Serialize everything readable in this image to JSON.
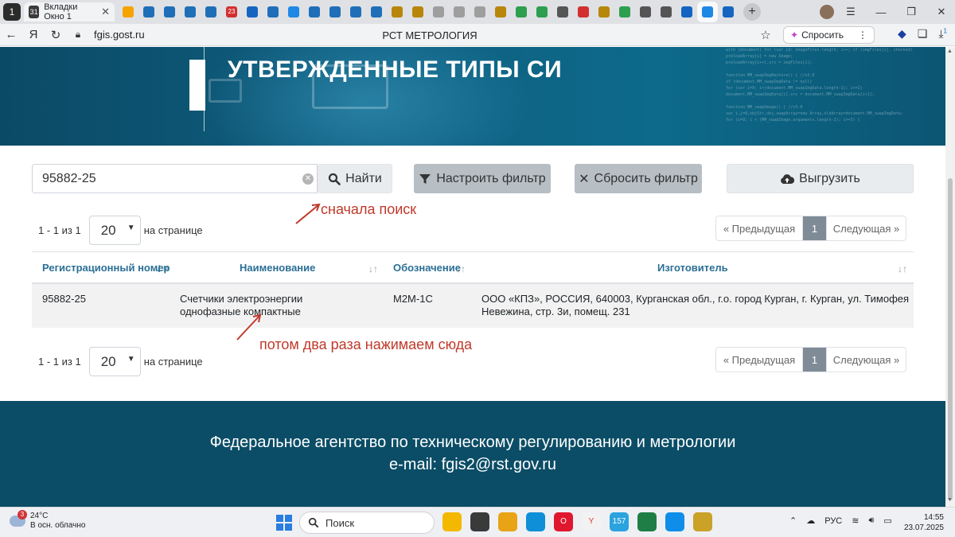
{
  "browser": {
    "tab_count": "1",
    "active_tab": {
      "label": "Вкладки Окно 1",
      "calendar_day": "31"
    },
    "favicons": [
      {
        "name": "mail-favicon",
        "color": "#f4a300",
        "label": ""
      },
      {
        "name": "site-favicon-1",
        "color": "#1f6fb8",
        "label": ""
      },
      {
        "name": "site-favicon-2",
        "color": "#1f6fb8",
        "label": ""
      },
      {
        "name": "site-favicon-3",
        "color": "#1f6fb8",
        "label": ""
      },
      {
        "name": "site-favicon-4",
        "color": "#1f6fb8",
        "label": ""
      },
      {
        "name": "badge-favicon",
        "color": "#d32f2f",
        "label": "23"
      },
      {
        "name": "site-favicon-5",
        "color": "#1565c0",
        "label": ""
      },
      {
        "name": "site-favicon-6",
        "color": "#1f6fb8",
        "label": ""
      },
      {
        "name": "shield-favicon",
        "color": "#1e88e5",
        "label": ""
      },
      {
        "name": "site-favicon-7",
        "color": "#1f6fb8",
        "label": ""
      },
      {
        "name": "site-favicon-8",
        "color": "#1f6fb8",
        "label": ""
      },
      {
        "name": "site-favicon-9",
        "color": "#1f6fb8",
        "label": ""
      },
      {
        "name": "site-favicon-10",
        "color": "#1f6fb8",
        "label": ""
      },
      {
        "name": "emblem-favicon-1",
        "color": "#b8860b",
        "label": ""
      },
      {
        "name": "emblem-favicon-2",
        "color": "#b8860b",
        "label": ""
      },
      {
        "name": "document-favicon-1",
        "color": "#9e9e9e",
        "label": ""
      },
      {
        "name": "document-favicon-2",
        "color": "#9e9e9e",
        "label": ""
      },
      {
        "name": "document-favicon-3",
        "color": "#9e9e9e",
        "label": ""
      },
      {
        "name": "emblem-favicon-3",
        "color": "#b8860b",
        "label": ""
      },
      {
        "name": "green-cross-favicon-1",
        "color": "#2e9e4f",
        "label": ""
      },
      {
        "name": "green-cross-favicon-2",
        "color": "#2e9e4f",
        "label": ""
      },
      {
        "name": "figure-favicon-1",
        "color": "#555555",
        "label": ""
      },
      {
        "name": "red-diamond-favicon",
        "color": "#d32f2f",
        "label": ""
      },
      {
        "name": "emblem-favicon-4",
        "color": "#b8860b",
        "label": ""
      },
      {
        "name": "green-cross-favicon-3",
        "color": "#2e9e4f",
        "label": ""
      },
      {
        "name": "figure-favicon-2",
        "color": "#555555",
        "label": ""
      },
      {
        "name": "figure-favicon-3",
        "color": "#555555",
        "label": ""
      },
      {
        "name": "blue-dot-favicon-1",
        "color": "#1565c0",
        "label": ""
      },
      {
        "name": "active-site-favicon",
        "color": "#1e88e5",
        "label": ""
      },
      {
        "name": "blue-dot-favicon-2",
        "color": "#1565c0",
        "label": ""
      }
    ],
    "address": {
      "host": "fgis.gost.ru",
      "page_title": "РСТ МЕТРОЛОГИЯ"
    },
    "ask_button": "Спросить",
    "downloads_badge": "1"
  },
  "page": {
    "banner_title": "УТВЕРЖДЕННЫЕ ТИПЫ СИ",
    "banner_code": "with (document) for (var id: imageFiles.length; i++) if (imgFiles[i]. checked)\npreloadArray[i] = new Image;\npreloadArray[i++].src = imgFiles[i];\n\nfunction MM_swapImgRestore() { //v3.0\nif (document.MM_swapImgData != null)\nfor (var i=0; i<(document.MM_swapImgData.length-1); i+=2)\ndocument.MM_swapImgData[i].src = document.MM_swapImgData[i+1];\n\nfunction MM_swapImage() { //v3.0\nvar i,j=0,objStr,obj,swapArray=new Array,oldArray=document.MM_swapImgData;\nfor (i=0; i < (MM_swapImage.arguments.length-2); i+=3) {",
    "search": {
      "value": "95882-25",
      "placeholder": ""
    },
    "buttons": {
      "find": "Найти",
      "configure_filter": "Настроить фильтр",
      "reset_filter": "Сбросить фильтр",
      "export": "Выгрузить"
    },
    "annotations": {
      "first": "сначала поиск",
      "second": "потом два раза нажимаем сюда",
      "color": "#c0392b"
    },
    "pagination": {
      "range_text": "1 - 1 из 1",
      "page_size": "20",
      "per_page_label": "на странице",
      "prev": "Предыдущая",
      "current_page": "1",
      "next": "Следующая"
    },
    "table": {
      "headers": [
        "Регистрационный номер",
        "Наименование",
        "Обозначение",
        "Изготовитель"
      ],
      "rows": [
        {
          "reg_number": "95882-25",
          "name": "Счетчики электроэнергии однофазные компактные",
          "designation": "M2M-1C",
          "manufacturer": "ООО «КПЗ», РОССИЯ, 640003, Курганская обл., г.о. город Курган, г. Курган, ул. Тимофея Невежина, стр. 3и, помещ. 231"
        }
      ]
    },
    "footer": {
      "agency": "Федеральное агентство по техническому регулированию и метрологии",
      "email": "e-mail: fgis2@rst.gov.ru"
    }
  },
  "taskbar": {
    "weather": {
      "temp": "24°C",
      "desc": "В осн. облачно",
      "badge": "3"
    },
    "search_label": "Поиск",
    "apps": [
      {
        "name": "file-explorer-icon",
        "color": "#f5b800",
        "label": ""
      },
      {
        "name": "task-view-icon",
        "color": "#3a3a3a",
        "label": ""
      },
      {
        "name": "folder-icon",
        "color": "#e8a317",
        "label": ""
      },
      {
        "name": "edge-icon",
        "color": "#0f8fd8",
        "label": ""
      },
      {
        "name": "opera-icon",
        "color": "#e0182d",
        "label": "O"
      },
      {
        "name": "yandex-browser-icon",
        "color": "#f2f2f2",
        "label": "Y"
      },
      {
        "name": "telegram-icon",
        "color": "#2aa3de",
        "label": "157"
      },
      {
        "name": "spreadsheet-icon",
        "color": "#1e7e45",
        "label": ""
      },
      {
        "name": "teamviewer-icon",
        "color": "#0e8ee9",
        "label": ""
      },
      {
        "name": "notes-app-icon",
        "color": "#c9a227",
        "label": ""
      }
    ],
    "language": "РУС",
    "time": "14:55",
    "date": "23.07.2025"
  }
}
